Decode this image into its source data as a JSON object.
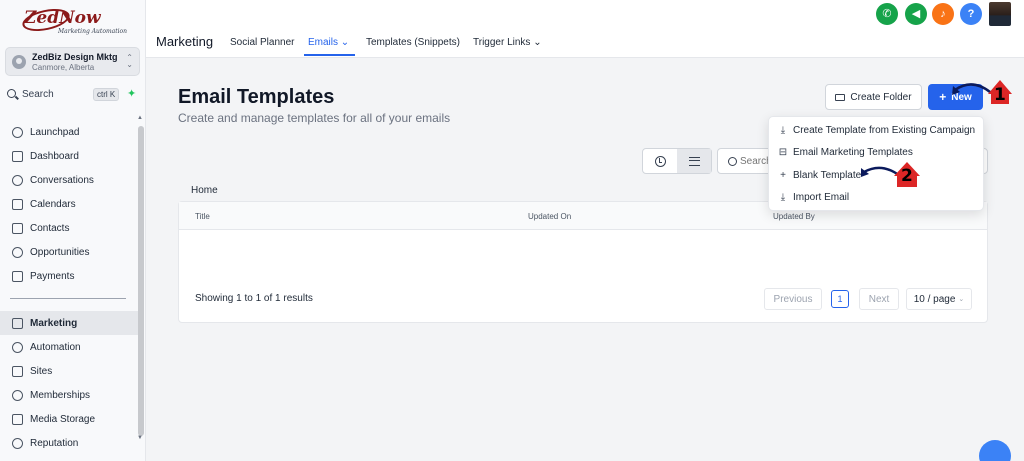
{
  "brand": {
    "logo_text": "ZedNow",
    "logo_tagline": "Marketing Automation"
  },
  "account": {
    "name": "ZedBiz Design Mktg",
    "location": "Canmore, Alberta"
  },
  "sidebar_search": {
    "label": "Search",
    "shortcut": "ctrl K"
  },
  "sidebar": {
    "items": [
      {
        "label": "Launchpad"
      },
      {
        "label": "Dashboard"
      },
      {
        "label": "Conversations"
      },
      {
        "label": "Calendars"
      },
      {
        "label": "Contacts"
      },
      {
        "label": "Opportunities"
      },
      {
        "label": "Payments"
      }
    ],
    "items2": [
      {
        "label": "Marketing",
        "active": true
      },
      {
        "label": "Automation"
      },
      {
        "label": "Sites"
      },
      {
        "label": "Memberships"
      },
      {
        "label": "Media Storage"
      },
      {
        "label": "Reputation"
      }
    ]
  },
  "topnav": {
    "section": "Marketing",
    "tabs": [
      {
        "label": "Social Planner"
      },
      {
        "label": "Emails",
        "active": true
      },
      {
        "label": "Templates (Snippets)"
      },
      {
        "label": "Trigger Links"
      }
    ]
  },
  "header_icons": {
    "phone_color": "#16a34a",
    "megaphone_color": "#16a34a",
    "bell_color": "#f97316",
    "help_color": "#3b82f6",
    "help_label": "?"
  },
  "page": {
    "title": "Email Templates",
    "subtitle": "Create and manage templates for all of your emails",
    "create_folder_label": "Create Folder",
    "new_label": "New",
    "search_placeholder": "Search"
  },
  "dropdown": {
    "items": [
      {
        "label": "Create Template from Existing Campaign",
        "icon": "download-icon"
      },
      {
        "label": "Email Marketing Templates",
        "icon": "inbox-icon"
      },
      {
        "label": "Blank Template",
        "icon": "plus-icon"
      },
      {
        "label": "Import Email",
        "icon": "import-icon"
      }
    ]
  },
  "table": {
    "breadcrumb": "Home",
    "columns": [
      "Title",
      "Updated On",
      "Updated By"
    ],
    "showing": "Showing 1 to 1 of 1 results",
    "previous": "Previous",
    "page": "1",
    "next": "Next",
    "page_size": "10 / page"
  },
  "annotations": {
    "step1": "1",
    "step2": "2",
    "color": "#dc2626"
  }
}
